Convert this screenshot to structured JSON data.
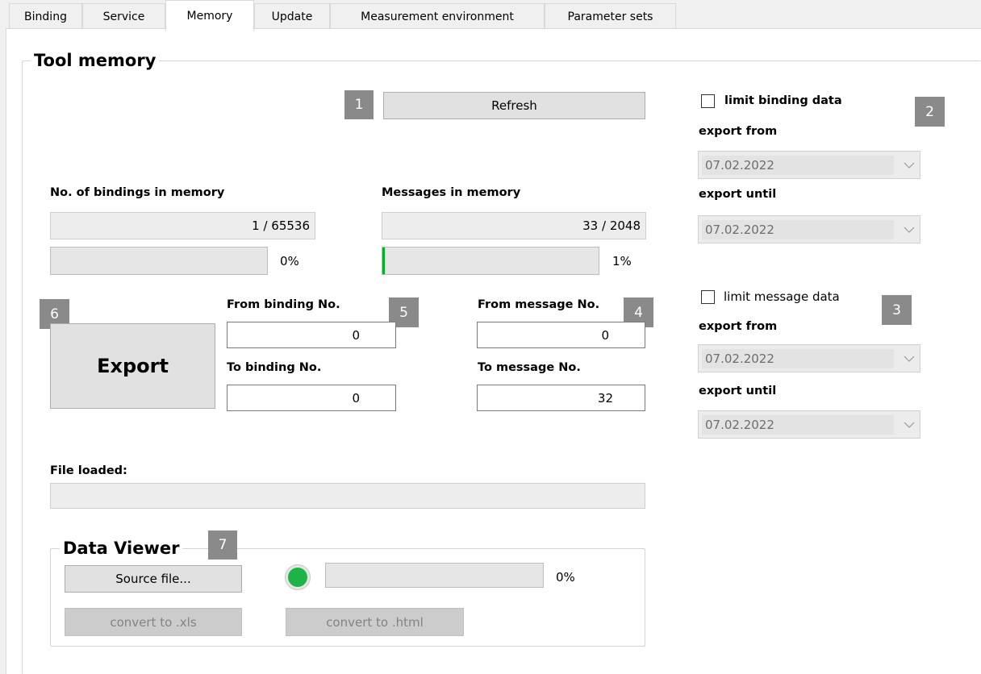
{
  "tabs": [
    {
      "label": "Binding"
    },
    {
      "label": "Service"
    },
    {
      "label": "Memory"
    },
    {
      "label": "Update"
    },
    {
      "label": "Measurement environment"
    },
    {
      "label": "Parameter sets"
    }
  ],
  "active_tab": "Memory",
  "tool_memory": {
    "title": "Tool memory",
    "refresh_label": "Refresh",
    "bindings_label": "No. of bindings in memory",
    "bindings_value": "1 / 65536",
    "bindings_percent": "0%",
    "bindings_progress": 0,
    "messages_label": "Messages in memory",
    "messages_value": "33 / 2048",
    "messages_percent": "1%",
    "messages_progress": 0.01,
    "export_label": "Export",
    "from_binding_label": "From binding No.",
    "from_binding_value": "0",
    "to_binding_label": "To binding No.",
    "to_binding_value": "0",
    "from_message_label": "From message No.",
    "from_message_value": "0",
    "to_message_label": "To message No.",
    "to_message_value": "32",
    "file_loaded_label": "File loaded:",
    "file_loaded_value": ""
  },
  "limit_binding": {
    "checkbox_label": "limit binding data",
    "checked": false,
    "export_from_label": "export from",
    "export_from_value": "07.02.2022",
    "export_until_label": "export until",
    "export_until_value": "07.02.2022"
  },
  "limit_message": {
    "checkbox_label": "limit message data",
    "checked": false,
    "export_from_label": "export from",
    "export_from_value": "07.02.2022",
    "export_until_label": "export until",
    "export_until_value": "07.02.2022"
  },
  "data_viewer": {
    "title": "Data Viewer",
    "source_file_label": "Source file...",
    "convert_xls_label": "convert to .xls",
    "convert_html_label": "convert to .html",
    "progress_percent": "0%",
    "progress": 0,
    "status_color": "#1db346"
  },
  "badges": [
    "1",
    "2",
    "3",
    "4",
    "5",
    "6",
    "7"
  ]
}
